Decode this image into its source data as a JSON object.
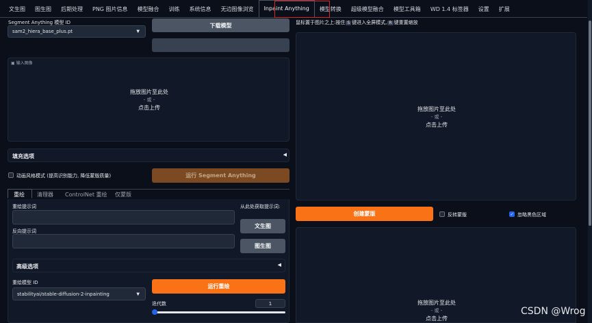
{
  "nav": {
    "tabs": [
      "文生图",
      "图生图",
      "后期处理",
      "PNG 图片信息",
      "模型融合",
      "训练",
      "系统信息",
      "无边图像浏览",
      "Inpaint Anything",
      "模型转换",
      "超级模型融合",
      "模型工具箱",
      "WD 1.4 标签器",
      "设置",
      "扩展"
    ],
    "active": "Inpaint Anything"
  },
  "segment": {
    "model_label": "Segment Anything 模型 ID",
    "model_value": "sam2_hiera_base_plus.pt",
    "download_button": "下载模型"
  },
  "input_image": {
    "label": "输入图像",
    "drop": "拖放图片至此处",
    "or": "- 或 -",
    "click": "点击上传"
  },
  "fill_options": "填充选项",
  "anime_checkbox": "动画风格模式 (提高识别能力, 降低蒙版质量)",
  "run_segment": "运行 Segment Anything",
  "subtabs": [
    "重绘",
    "清理器",
    "ControlNet 重绘",
    "仅蒙版"
  ],
  "inpaint": {
    "prompt_label": "重绘提示词",
    "negative_label": "反向提示词",
    "get_prompt_label": "从此处获取提示词:",
    "txt2img_button": "文生图",
    "img2img_button": "图生图",
    "advanced": "高级选项",
    "model_label": "重绘模型 ID",
    "model_value": "stabilityai/stable-diffusion-2-inpainting",
    "run_button": "运行重绘",
    "steps_label": "迭代数",
    "steps_value": "1",
    "steps_fraction": 0.0
  },
  "right": {
    "hint_prefix": "鼠标置于图片之上:按住",
    "hint_key1": "S",
    "hint_mid": "键进入全屏模式,",
    "hint_key2": "R",
    "hint_suffix": "键重置缩放",
    "sel_drop": "拖放图片至此处",
    "sel_or": "- 或 -",
    "sel_click": "点击上传",
    "create_mask": "创建蒙版",
    "invert_mask": "反转蒙版",
    "ignore_black": "忽略黑色区域",
    "out_drop": "拖放图片至此处",
    "out_or": "- 或 -",
    "out_click": "点击上传"
  },
  "watermark": "CSDN @Wrog"
}
